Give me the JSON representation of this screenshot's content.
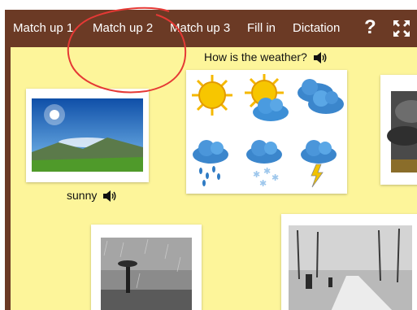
{
  "nav": {
    "tabs": [
      "Match up 1",
      "Match up 2",
      "Match up 3",
      "Fill in",
      "Dictation"
    ],
    "help_icon": "question-icon",
    "fullscreen_icon": "fullscreen-icon"
  },
  "activity": {
    "prompt": "How is the weather?",
    "answer_word": "sunny"
  },
  "weather_icons": [
    "sunny",
    "partly-cloudy",
    "cloudy",
    "rainy",
    "snowy",
    "stormy"
  ],
  "colors": {
    "nav_background": "#6b3a25",
    "content_background": "#fdf59a",
    "annotation": "#e53935"
  }
}
